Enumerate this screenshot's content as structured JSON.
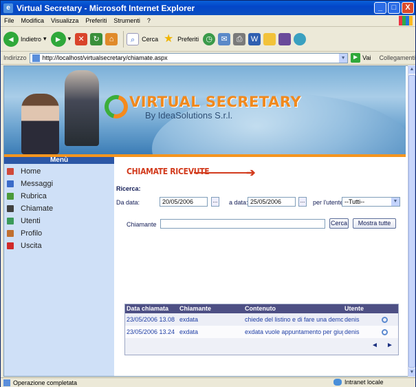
{
  "window": {
    "title": "Virtual Secretary - Microsoft Internet Explorer",
    "controls": [
      "_",
      "□",
      "X"
    ]
  },
  "menubar": [
    "File",
    "Modifica",
    "Visualizza",
    "Preferiti",
    "Strumenti",
    "?"
  ],
  "toolbar": {
    "back": "Indietro",
    "search": "Cerca",
    "favorites": "Preferiti"
  },
  "address": {
    "label": "Indirizzo",
    "url": "http://localhost/virtualsecretary/chiamate.aspx",
    "go": "Vai",
    "links": "Collegamenti"
  },
  "banner": {
    "brand": "VIRTUAL SECRETARY",
    "subtitle": "By IdeaSolutions S.r.l."
  },
  "sidebar": {
    "title": "Menù",
    "items": [
      {
        "label": "Home",
        "color": "#d0493a"
      },
      {
        "label": "Messaggi",
        "color": "#3b6cc9"
      },
      {
        "label": "Rubrica",
        "color": "#4b9a3a"
      },
      {
        "label": "Chiamate",
        "color": "#404040"
      },
      {
        "label": "Utenti",
        "color": "#3b9a5a"
      },
      {
        "label": "Profilo",
        "color": "#c07030"
      },
      {
        "label": "Uscita",
        "color": "#d02a2a"
      }
    ]
  },
  "main": {
    "title": "CHIAMATE RICEVUTE",
    "search_heading": "Ricerca:",
    "from_label": "Da data:",
    "from_value": "20/05/2006",
    "to_label": "a data:",
    "to_value": "25/05/2006",
    "user_label": "per l'utente:",
    "user_value": "--Tutti--",
    "caller_label": "Chiamante",
    "caller_value": "",
    "search_button": "Cerca",
    "show_all_button": "Mostra tutte",
    "dots": "..."
  },
  "table": {
    "columns": [
      "Data chiamata",
      "Chiamante",
      "Contenuto",
      "Utente"
    ],
    "rows": [
      [
        "23/05/2006 13.08",
        "exdata",
        "chiede del listino e di fare una demo il...",
        "denis"
      ],
      [
        "23/05/2006 13.24",
        "exdata",
        "exdata vuole appuntamento per giugno",
        "denis"
      ]
    ],
    "prev": "◄",
    "next": "►"
  },
  "status": {
    "text": "Operazione completata",
    "zone": "Intranet locale"
  }
}
